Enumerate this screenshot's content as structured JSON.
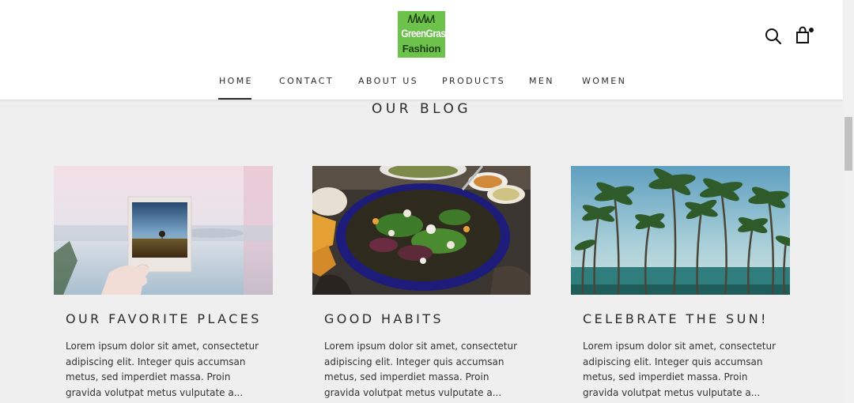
{
  "header": {
    "logo": {
      "line1": "GreenGrass",
      "line2": "Fashion",
      "background_color": "#6cc24a",
      "icon": "grass-icon"
    },
    "search": {
      "icon": "search-icon"
    },
    "cart": {
      "icon": "shopping-bag-icon",
      "has_items_indicator": true
    }
  },
  "nav": {
    "items": [
      {
        "label": "HOME",
        "active": true
      },
      {
        "label": "CONTACT",
        "active": false
      },
      {
        "label": "ABOUT US",
        "active": false
      },
      {
        "label": "PRODUCTS",
        "active": false
      },
      {
        "label": "MEN",
        "active": false
      },
      {
        "label": "WOMEN",
        "active": false
      }
    ]
  },
  "blog": {
    "title": "OUR BLOG",
    "posts": [
      {
        "title": "OUR FAVORITE PLACES",
        "excerpt": "Lorem ipsum dolor sit amet, consectetur adipiscing elit. Integer quis accumsan metus, sed imperdiet massa. Proin gravida volutpat metus vulputate a...",
        "image": "polaroid-photo-image"
      },
      {
        "title": "GOOD HABITS",
        "excerpt": "Lorem ipsum dolor sit amet, consectetur adipiscing elit. Integer quis accumsan metus, sed imperdiet massa. Proin gravida volutpat metus vulputate a...",
        "image": "salad-bowl-image"
      },
      {
        "title": "CELEBRATE THE SUN!",
        "excerpt": "Lorem ipsum dolor sit amet, consectetur adipiscing elit. Integer quis accumsan metus, sed imperdiet massa. Proin gravida volutpat metus vulputate a...",
        "image": "palm-trees-image"
      }
    ]
  },
  "colors": {
    "page_background": "#efefef",
    "header_background": "#ffffff",
    "text": "#2b2b2b"
  }
}
